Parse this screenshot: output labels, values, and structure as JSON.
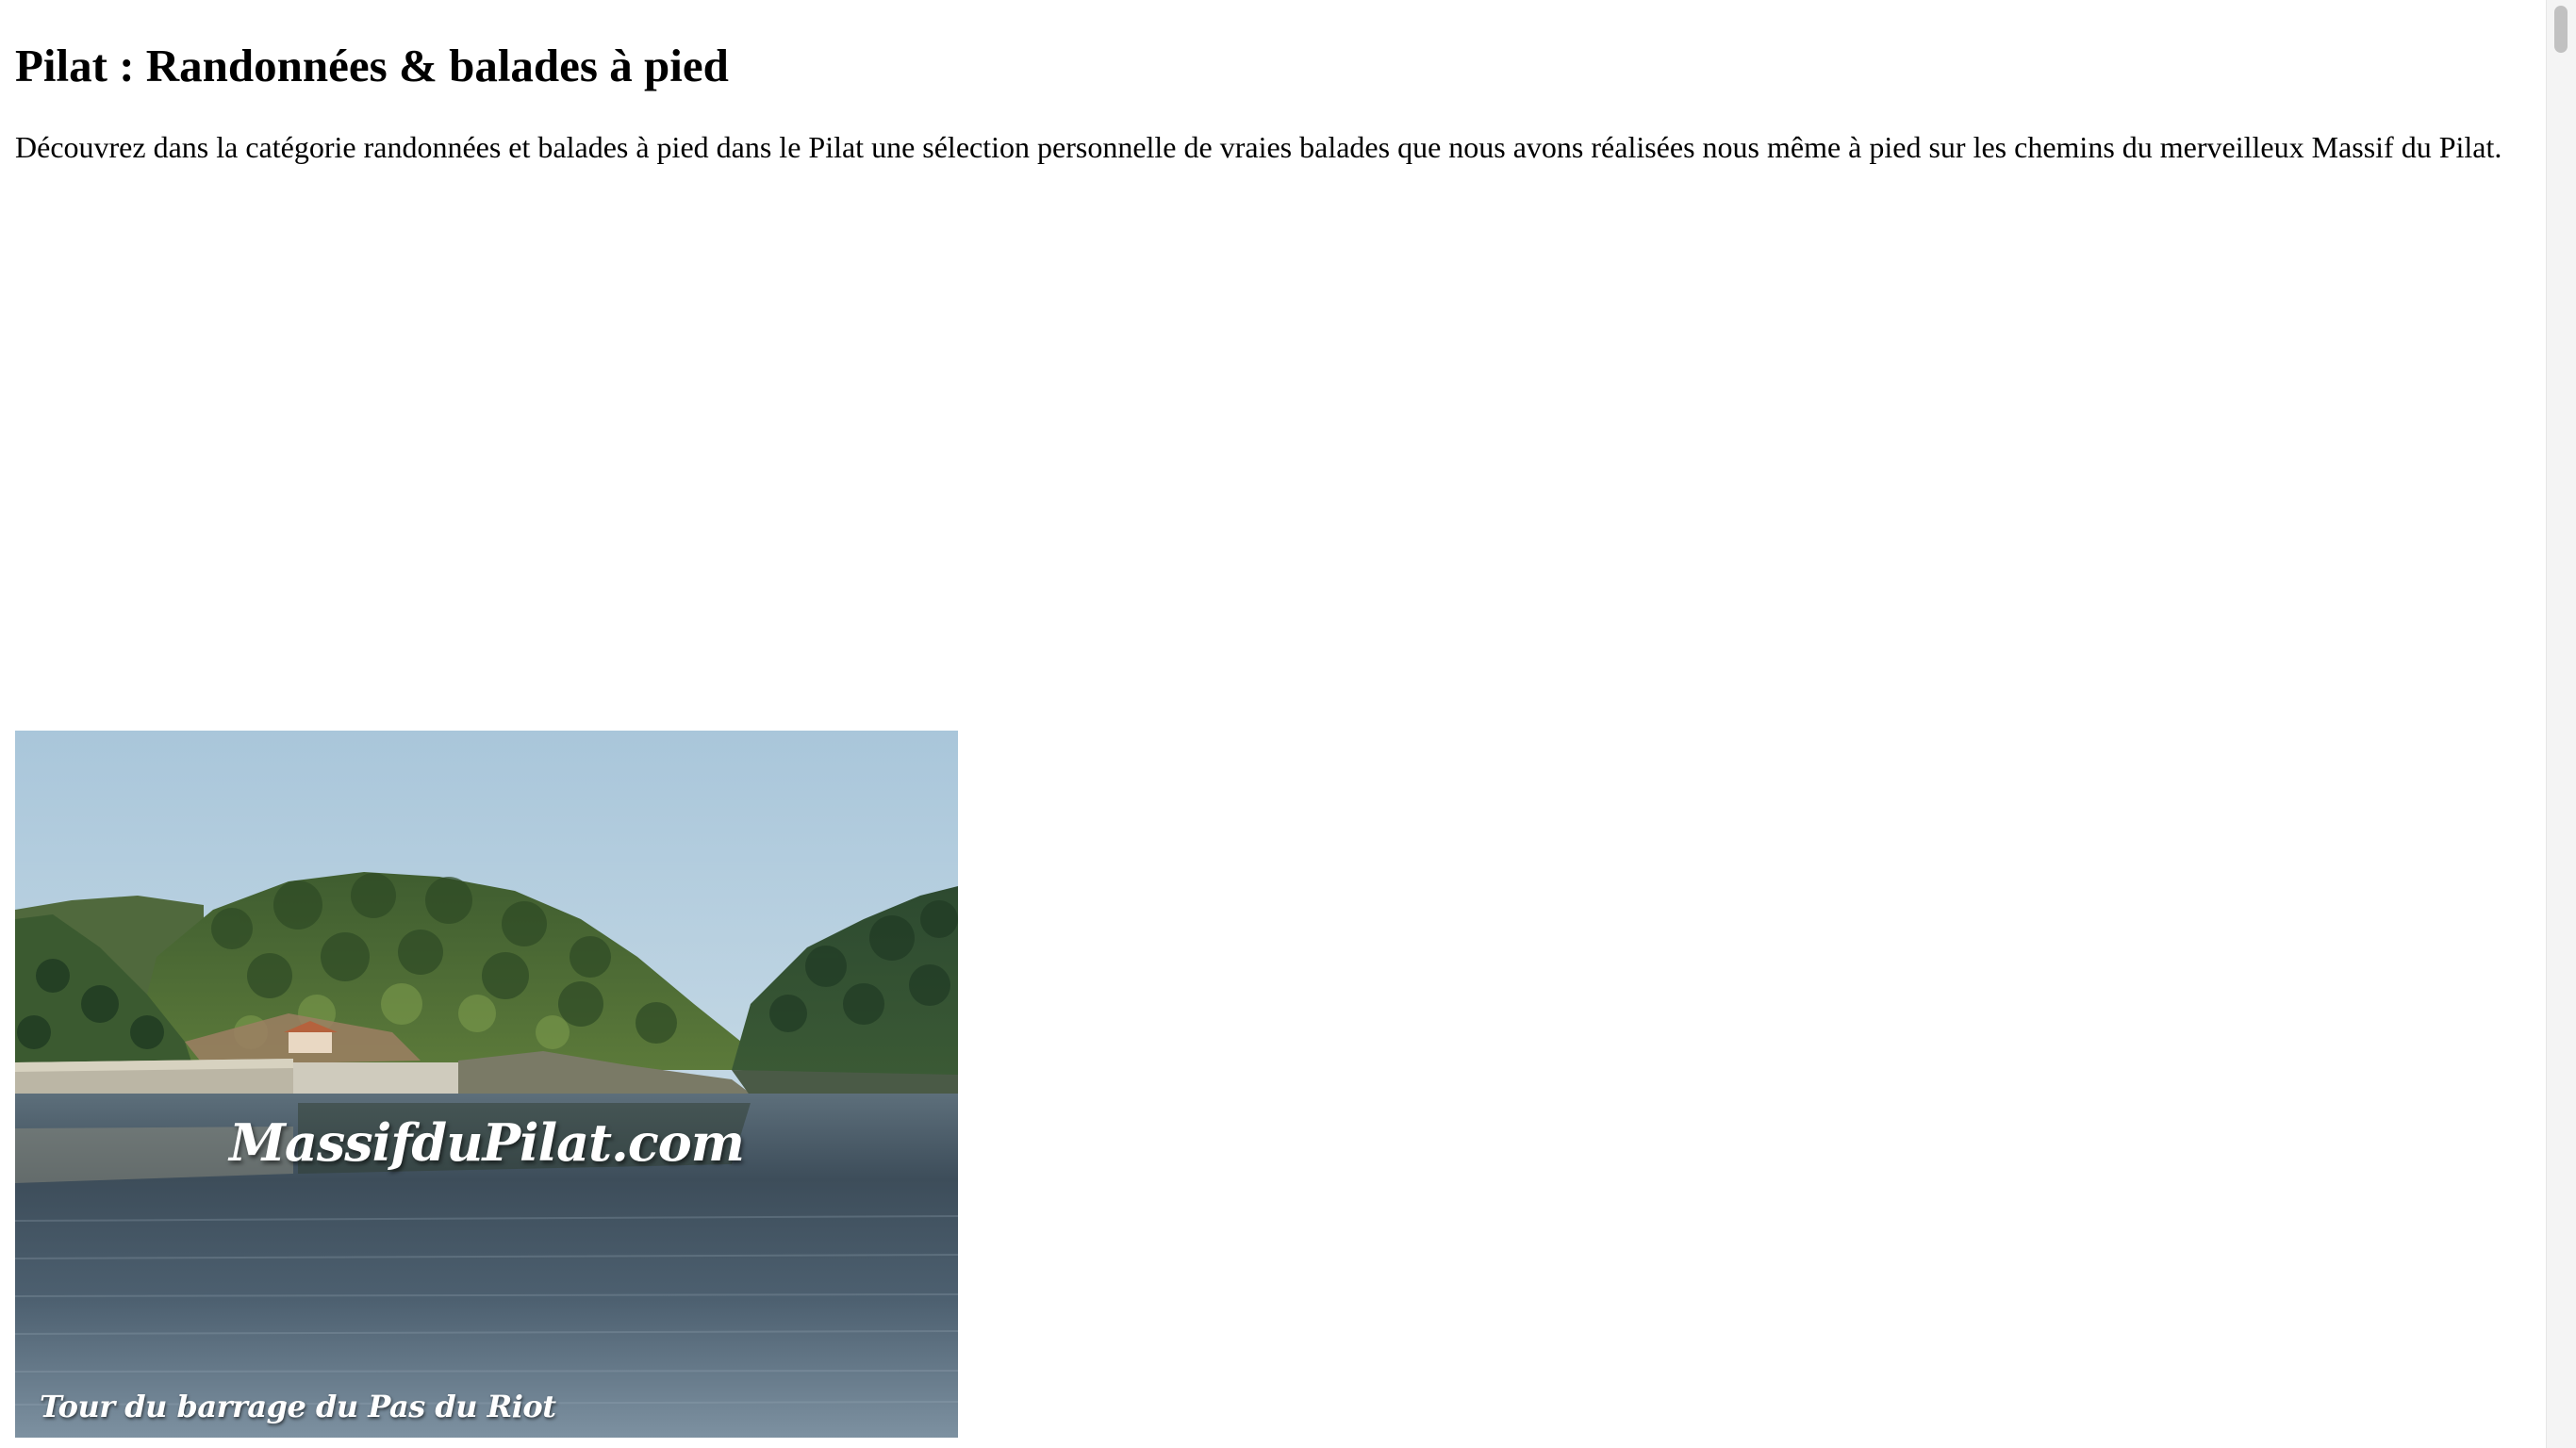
{
  "page": {
    "title": "Pilat : Randonnées & balades à pied",
    "intro": "Découvrez dans la catégorie randonnées et balades à pied dans le Pilat une sélection personnelle de vraies balades que nous avons réalisées nous même à pied sur les chemins du merveilleux Massif du Pilat."
  },
  "cards": [
    {
      "watermark": "MassifduPilat.com",
      "caption": "Tour du barrage du Pas du Riot"
    }
  ],
  "colors": {
    "sky_top": "#a8c8dc",
    "sky_bottom": "#dbe8ee",
    "forest_dark": "#2f4a2a",
    "forest_light": "#5f7d3c",
    "water_dark": "#2f3d4a",
    "water_light": "#6d8192",
    "dam": "#bcb7a8",
    "scrollbar_thumb": "#c1c1c1"
  }
}
